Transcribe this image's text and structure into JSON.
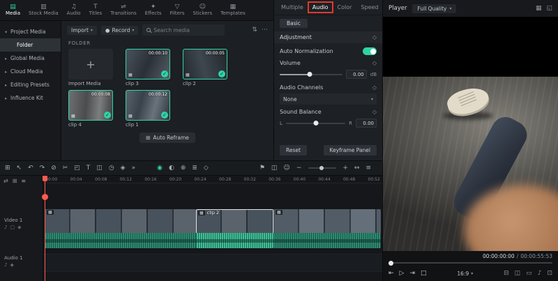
{
  "colors": {
    "accent": "#2fd3a6",
    "annotation": "#e0392e",
    "playhead": "#ff5a4e"
  },
  "glyphs": {
    "caret": "▾",
    "dots": "⋯",
    "filter": "⇅",
    "plus": "+",
    "check": "✓",
    "badge": "▦",
    "diamond": "◇",
    "record_dot": "●",
    "chip": "▦"
  },
  "ribbon": {
    "tabs": [
      {
        "name": "tab-media",
        "label": "Media",
        "icon": "▤",
        "cls": "active"
      },
      {
        "name": "tab-stock-media",
        "label": "Stock Media",
        "icon": "▥",
        "cls": ""
      },
      {
        "name": "tab-audio",
        "label": "Audio",
        "icon": "♫",
        "cls": ""
      },
      {
        "name": "tab-titles",
        "label": "Titles",
        "icon": "T",
        "cls": ""
      },
      {
        "name": "tab-transitions",
        "label": "Transitions",
        "icon": "⇌",
        "cls": ""
      },
      {
        "name": "tab-effects",
        "label": "Effects",
        "icon": "✦",
        "cls": ""
      },
      {
        "name": "tab-filters",
        "label": "Filters",
        "icon": "▽",
        "cls": ""
      },
      {
        "name": "tab-stickers",
        "label": "Stickers",
        "icon": "☺",
        "cls": ""
      },
      {
        "name": "tab-templates",
        "label": "Templates",
        "icon": "▦",
        "cls": ""
      }
    ]
  },
  "sidebar": {
    "items": [
      {
        "name": "sidebar-item-project-media",
        "label": "Project Media",
        "chevron": "▾",
        "cls": ""
      },
      {
        "name": "sidebar-item-folder",
        "label": "Folder",
        "chevron": "",
        "cls": "selected child"
      },
      {
        "name": "sidebar-item-global-media",
        "label": "Global Media",
        "chevron": "▸",
        "cls": ""
      },
      {
        "name": "sidebar-item-cloud-media",
        "label": "Cloud Media",
        "chevron": "▸",
        "cls": ""
      },
      {
        "name": "sidebar-item-editing-presets",
        "label": "Editing Presets",
        "chevron": "▸",
        "cls": ""
      },
      {
        "name": "sidebar-item-influence-kit",
        "label": "Influence Kit",
        "chevron": "▸",
        "cls": ""
      }
    ]
  },
  "media": {
    "import_button": "Import",
    "record_button": "Record",
    "search_placeholder": "Search media",
    "breadcrumb": "FOLDER",
    "import_tile_label": "Import Media",
    "auto_reframe": {
      "icon": "⊞",
      "label": "Auto Reframe"
    },
    "clips": [
      {
        "name": "media-clip-3",
        "label": "clip 3",
        "duration": "00:00:10",
        "cls": "t3"
      },
      {
        "name": "media-clip-2",
        "label": "clip 2",
        "duration": "00:00:05",
        "cls": "t2"
      },
      {
        "name": "media-clip-4",
        "label": "clip 4",
        "duration": "00:00:08",
        "cls": "t4"
      },
      {
        "name": "media-clip-1",
        "label": "clip 1",
        "duration": "00:00:12",
        "cls": "t1"
      }
    ]
  },
  "properties": {
    "tabs": [
      {
        "name": "properties-tab-multiple",
        "label": "Multiple",
        "cls": ""
      },
      {
        "name": "properties-tab-audio",
        "label": "Audio",
        "cls": "active annotated"
      },
      {
        "name": "properties-tab-color",
        "label": "Color",
        "cls": ""
      },
      {
        "name": "properties-tab-speed",
        "label": "Speed",
        "cls": ""
      }
    ],
    "basic_tab": "Basic",
    "adjustment_label": "Adjustment",
    "auto_normalization_label": "Auto Normalization",
    "volume": {
      "label": "Volume",
      "value": "0.00",
      "unit": "dB"
    },
    "audio_channels": {
      "label": "Audio Channels",
      "value": "None"
    },
    "sound_balance": {
      "label": "Sound Balance",
      "left": "L",
      "right": "R",
      "value": "0.00"
    },
    "reset_button": "Reset",
    "keyframe_button": "Keyframe Panel"
  },
  "player": {
    "title": "Player",
    "quality": "Full Quality",
    "header_icons": [
      {
        "name": "grid-view-icon",
        "glyph": "▦"
      },
      {
        "name": "detach-player-icon",
        "glyph": "◱"
      }
    ],
    "timecode_current": "00:00:00:00",
    "timecode_separator": "/",
    "timecode_total": "00:00:55:53",
    "transport": [
      {
        "name": "previous-frame-button",
        "glyph": "⇤"
      },
      {
        "name": "play-button",
        "glyph": "▷"
      },
      {
        "name": "next-frame-button",
        "glyph": "⇥"
      },
      {
        "name": "stop-button",
        "glyph": "□"
      }
    ],
    "aspect_ratio": "16:9",
    "right_controls": [
      {
        "name": "mark-icon",
        "glyph": "⊟"
      },
      {
        "name": "snapshot-button",
        "glyph": "◫"
      },
      {
        "name": "display-mode-button",
        "glyph": "▭"
      },
      {
        "name": "volume-button",
        "glyph": "♪"
      },
      {
        "name": "fullscreen-button",
        "glyph": "⊡"
      }
    ]
  },
  "timeline_toolbar": {
    "left": [
      {
        "name": "toolbox-icon",
        "glyph": "⊞",
        "cls": ""
      },
      {
        "name": "select-tool-icon",
        "glyph": "↖",
        "cls": ""
      },
      {
        "name": "undo-icon",
        "glyph": "↶",
        "cls": ""
      },
      {
        "name": "redo-icon",
        "glyph": "↷",
        "cls": ""
      },
      {
        "name": "delete-icon",
        "glyph": "⊘",
        "cls": ""
      },
      {
        "name": "split-icon",
        "glyph": "✂",
        "cls": ""
      },
      {
        "name": "crop-icon",
        "glyph": "◰",
        "cls": ""
      },
      {
        "name": "text-tool-icon",
        "glyph": "T",
        "cls": ""
      },
      {
        "name": "pip-icon",
        "glyph": "◫",
        "cls": ""
      },
      {
        "name": "speed-icon",
        "glyph": "◷",
        "cls": ""
      },
      {
        "name": "keyframe-icon",
        "glyph": "◈",
        "cls": ""
      },
      {
        "name": "more-tools-icon",
        "glyph": "»",
        "cls": ""
      }
    ],
    "middle": [
      {
        "name": "chroma-key-icon",
        "glyph": "◉",
        "cls": "teal"
      },
      {
        "name": "mask-icon",
        "glyph": "◐",
        "cls": ""
      },
      {
        "name": "motion-track-icon",
        "glyph": "⊕",
        "cls": ""
      },
      {
        "name": "audio-mixer-icon",
        "glyph": "≣",
        "cls": ""
      },
      {
        "name": "keyframe-panel-icon",
        "glyph": "◇",
        "cls": ""
      }
    ],
    "right_a": [
      {
        "name": "marker-icon",
        "glyph": "⚑",
        "cls": ""
      },
      {
        "name": "export-frame-icon",
        "glyph": "◫",
        "cls": ""
      },
      {
        "name": "emoji-icon",
        "glyph": "☺",
        "cls": ""
      },
      {
        "name": "zoom-out-icon",
        "glyph": "−",
        "cls": ""
      }
    ],
    "right_b": [
      {
        "name": "zoom-in-icon",
        "glyph": "+",
        "cls": ""
      },
      {
        "name": "fit-timeline-icon",
        "glyph": "↔",
        "cls": ""
      },
      {
        "name": "track-options-icon",
        "glyph": "≡",
        "cls": ""
      }
    ]
  },
  "timeline": {
    "header_icons": [
      {
        "name": "swap-tracks-icon",
        "glyph": "⇄"
      },
      {
        "name": "add-track-icon",
        "glyph": "⊞"
      },
      {
        "name": "track-menu-icon",
        "glyph": "≡"
      }
    ],
    "ruler": [
      "00:00",
      "00:04",
      "00:08",
      "00:12",
      "00:16",
      "00:20",
      "00:24",
      "00:28",
      "00:32",
      "00:36",
      "00:40",
      "00:44",
      "00:48",
      "00:52"
    ],
    "video_track": {
      "label": "Video 1",
      "icons": [
        {
          "name": "mute-track-icon",
          "glyph": "♪"
        },
        {
          "name": "hide-track-icon",
          "glyph": "▢"
        },
        {
          "name": "lock-track-icon",
          "glyph": "◈"
        }
      ]
    },
    "audio_track": {
      "label": "Audio 1",
      "icons": [
        {
          "name": "mute-track-icon",
          "glyph": "♪"
        },
        {
          "name": "lock-track-icon",
          "glyph": "◈"
        }
      ]
    },
    "selected_clip_label": "clip 2"
  }
}
